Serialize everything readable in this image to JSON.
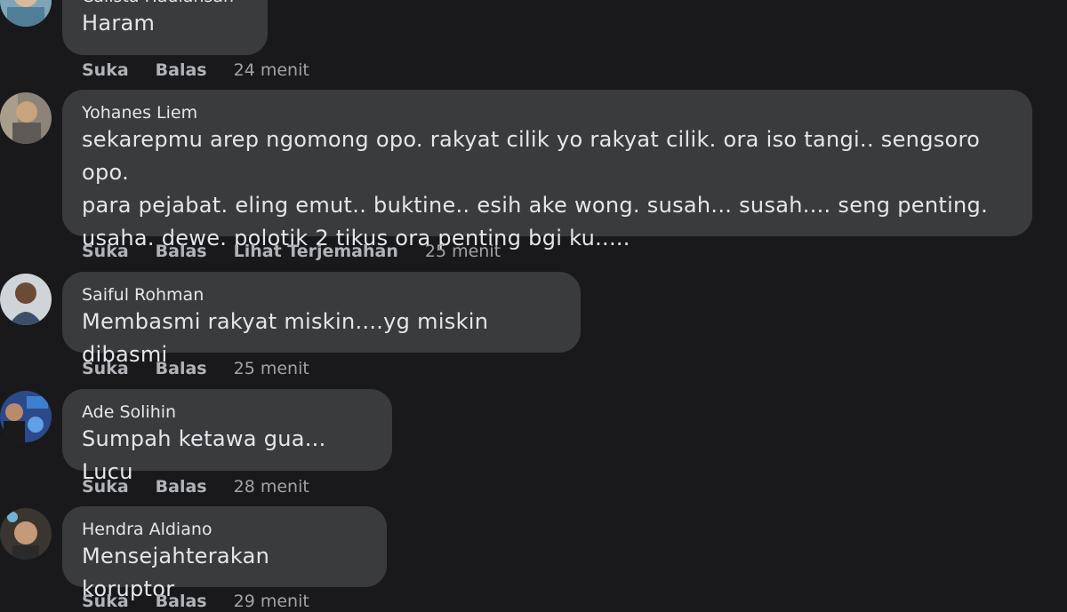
{
  "comments": [
    {
      "name": "Calista Hadiansah",
      "text": "Haram",
      "actions": [
        "Suka",
        "Balas"
      ],
      "time": "24 menit"
    },
    {
      "name": "Yohanes Liem",
      "text": "sekarepmu arep ngomong opo. rakyat cilik yo rakyat cilik. ora iso tangi.. sengsoro opo.\npara pejabat. eling emut.. buktine.. esih ake wong. susah... susah.... seng penting.\nusaha. dewe. polotik 2 tikus ora penting bgi ku.....",
      "actions": [
        "Suka",
        "Balas",
        "Lihat Terjemahan"
      ],
      "time": "25 menit"
    },
    {
      "name": "Saiful Rohman",
      "text": "Membasmi rakyat miskin....yg miskin dibasmi",
      "actions": [
        "Suka",
        "Balas"
      ],
      "time": "25 menit"
    },
    {
      "name": "Ade Solihin",
      "text": "Sumpah ketawa gua... Lucu",
      "actions": [
        "Suka",
        "Balas"
      ],
      "time": "28 menit"
    },
    {
      "name": "Hendra Aldiano",
      "text": "Mensejahterakan koruptor",
      "actions": [
        "Suka",
        "Balas"
      ],
      "time": "29 menit"
    }
  ]
}
